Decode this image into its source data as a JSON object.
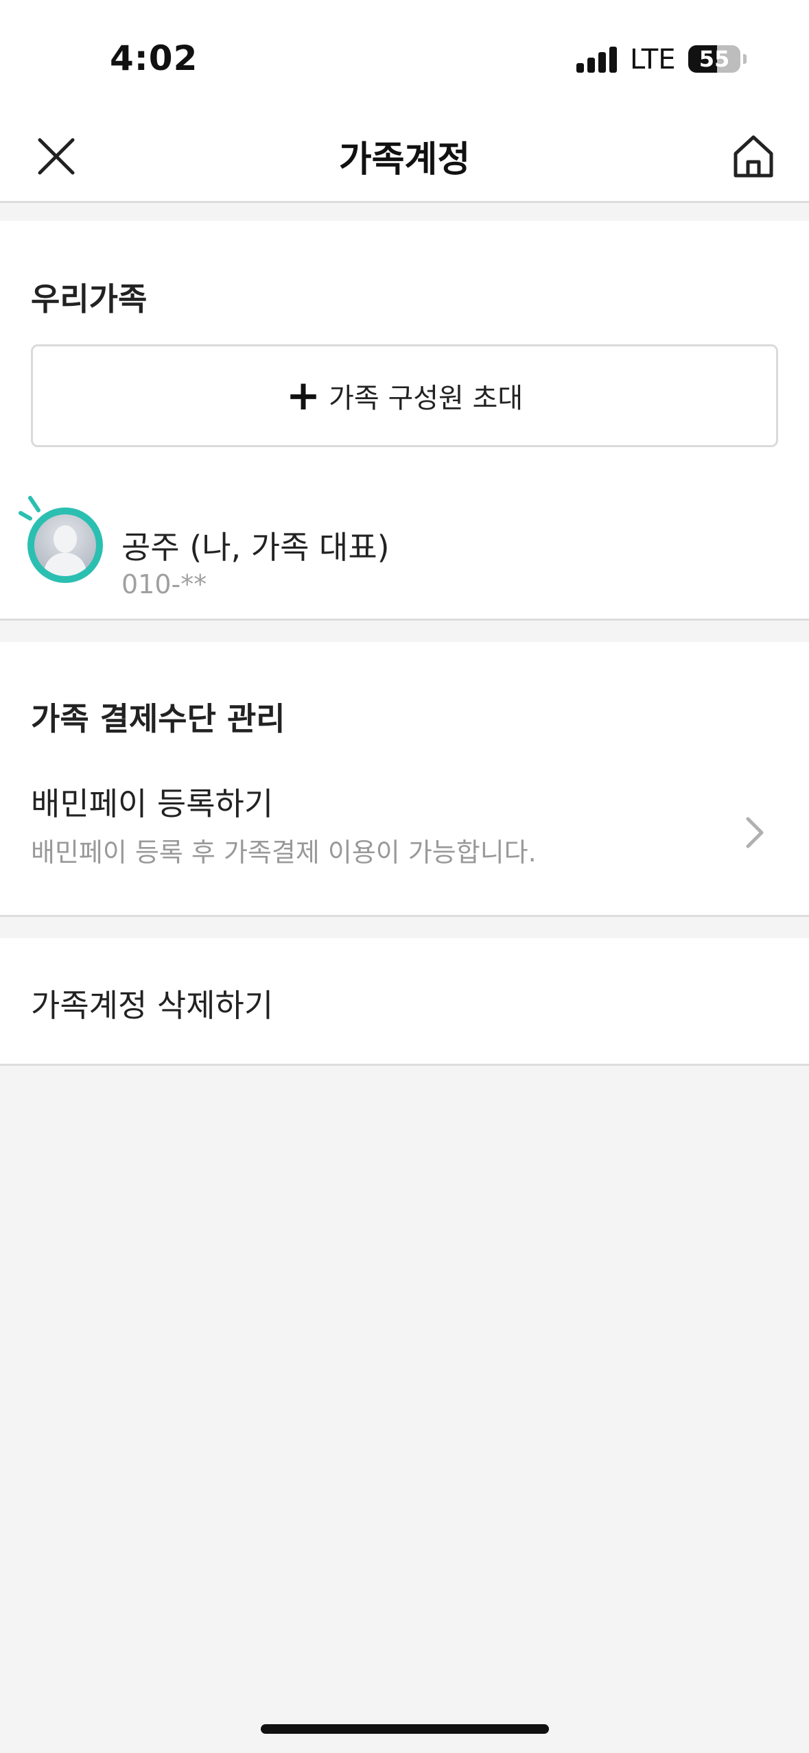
{
  "status_bar": {
    "time": "4:02",
    "network": "LTE",
    "battery": "55",
    "battery_level": 0.55
  },
  "header": {
    "title": "가족계정",
    "left_icon": "close-icon",
    "right_icon": "home-icon"
  },
  "family_section": {
    "title": "우리가족",
    "invite_button": {
      "icon": "plus-icon",
      "label": "가족 구성원 초대"
    },
    "members": [
      {
        "name": "공주 (나, 가족 대표)",
        "phone": "010-**"
      }
    ]
  },
  "payment_section": {
    "title": "가족 결제수단 관리",
    "item": {
      "title": "배민페이 등록하기",
      "description": "배민페이 등록 후 가족결제 이용이 가능합니다.",
      "icon": "chevron-right-icon"
    }
  },
  "delete_section": {
    "label": "가족계정 삭제하기"
  },
  "colors": {
    "accent": "#2bbfb1",
    "background": "#f4f4f4",
    "text": "#222222",
    "subtext": "#999999"
  }
}
